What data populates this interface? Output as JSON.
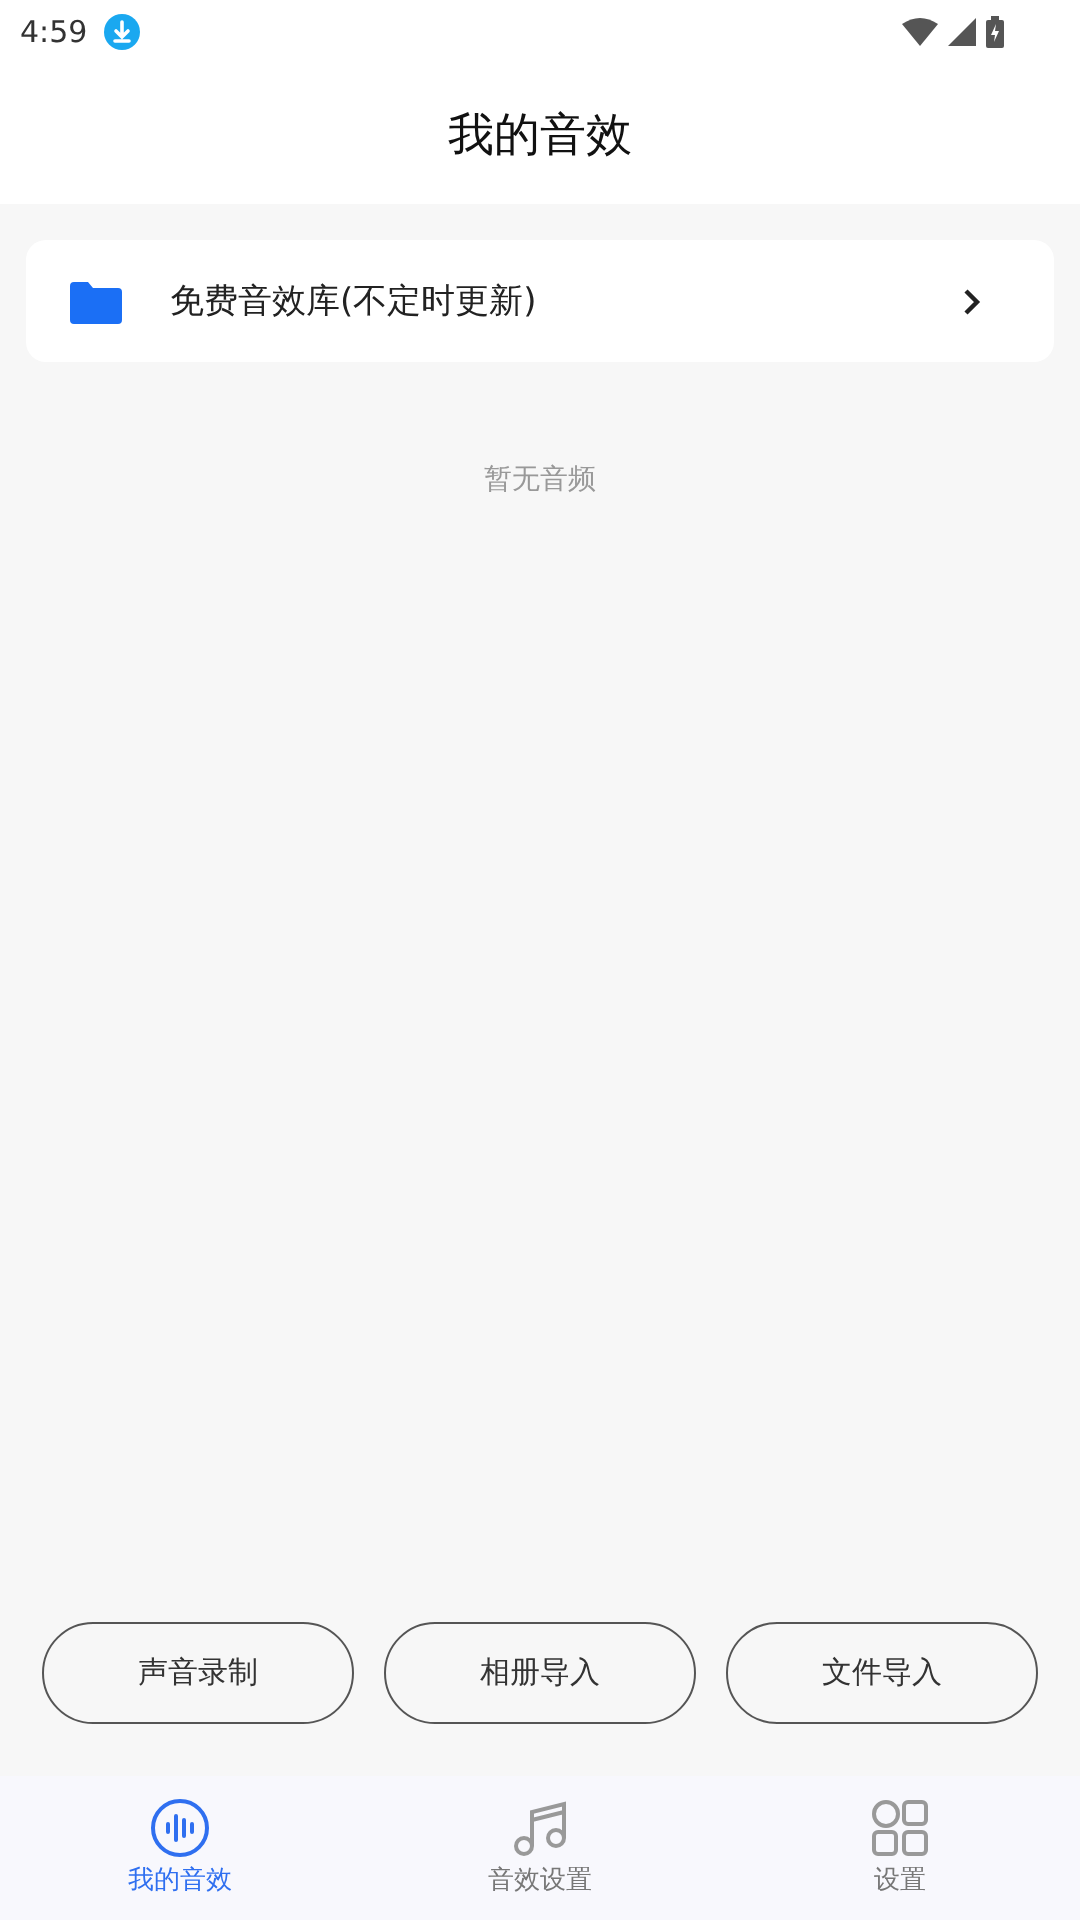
{
  "status_bar": {
    "time": "4:59"
  },
  "header": {
    "title": "我的音效"
  },
  "library_card": {
    "label": "免费音效库(不定时更新)"
  },
  "empty_message": "暂无音频",
  "actions": [
    {
      "label": "声音录制"
    },
    {
      "label": "相册导入"
    },
    {
      "label": "文件导入"
    }
  ],
  "nav_tabs": [
    {
      "label": "我的音效",
      "kind": "wave",
      "selected": true
    },
    {
      "label": "音效设置",
      "kind": "music",
      "selected": false
    },
    {
      "label": "设置",
      "kind": "grid",
      "selected": false
    }
  ]
}
